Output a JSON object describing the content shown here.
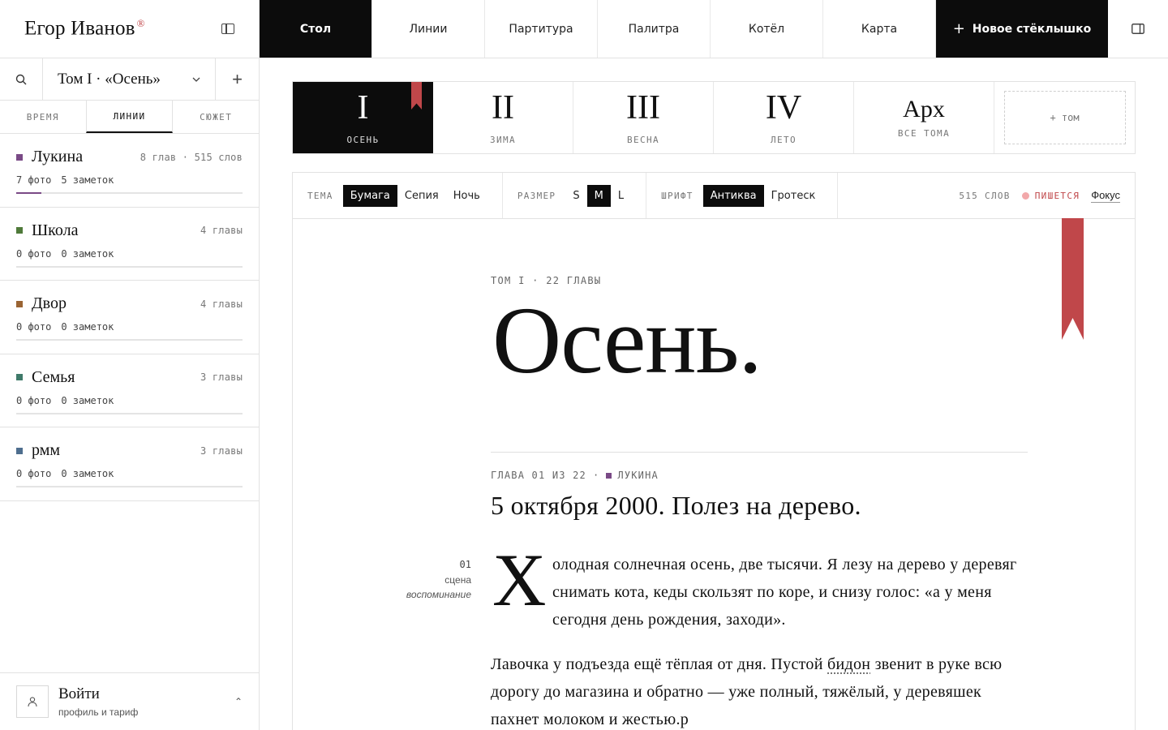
{
  "app": {
    "brand": "Егор Иванов",
    "brand_mark": "®"
  },
  "sidebar": {
    "volume_selector": "Том I · «Осень»",
    "add": "+",
    "tabs": [
      {
        "label": "ВРЕМЯ",
        "active": false
      },
      {
        "label": "ЛИНИИ",
        "active": true
      },
      {
        "label": "СЮЖЕТ",
        "active": false
      }
    ],
    "lines": [
      {
        "name": "Лукина",
        "meta": "8 глав · 515 слов",
        "photos": "7 фото",
        "notes": "5 заметок",
        "color": "#7a4a86",
        "progress": 0.11
      },
      {
        "name": "Школа",
        "meta": "4 главы",
        "photos": "0 фото",
        "notes": "0 заметок",
        "color": "#4f7a3a",
        "progress": 0
      },
      {
        "name": "Двор",
        "meta": "4 главы",
        "photos": "0 фото",
        "notes": "0 заметок",
        "color": "#9a6433",
        "progress": 0
      },
      {
        "name": "Семья",
        "meta": "3 главы",
        "photos": "0 фото",
        "notes": "0 заметок",
        "color": "#3f7a6a",
        "progress": 0
      },
      {
        "name": "рмм",
        "meta": "3 главы",
        "photos": "0 фото",
        "notes": "0 заметок",
        "color": "#4e6e8e",
        "progress": 0
      }
    ],
    "login": {
      "title": "Войти",
      "subtitle": "профиль и тариф",
      "chevron": "⌃"
    }
  },
  "topnav": {
    "items": [
      {
        "label": "Стол",
        "active": true
      },
      {
        "label": "Линии",
        "active": false
      },
      {
        "label": "Партитура",
        "active": false
      },
      {
        "label": "Палитра",
        "active": false
      },
      {
        "label": "Котёл",
        "active": false
      },
      {
        "label": "Карта",
        "active": false
      }
    ],
    "new_button": "Новое стёклышко"
  },
  "volumes": {
    "items": [
      {
        "num": "I",
        "caption": "ОСЕНЬ",
        "active": true
      },
      {
        "num": "II",
        "caption": "ЗИМА",
        "active": false
      },
      {
        "num": "III",
        "caption": "ВЕСНА",
        "active": false
      },
      {
        "num": "IV",
        "caption": "ЛЕТО",
        "active": false
      },
      {
        "num": "Арх",
        "caption": "ВСЕ ТОМА",
        "active": false
      }
    ],
    "add": "+ том"
  },
  "toolbar": {
    "theme_label": "ТЕМА",
    "themes": [
      "Бумага",
      "Сепия",
      "Ночь"
    ],
    "theme_selected": "Бумага",
    "size_label": "РАЗМЕР",
    "sizes": [
      "S",
      "M",
      "L"
    ],
    "size_selected": "M",
    "font_label": "ШРИФТ",
    "fonts": [
      "Антиква",
      "Гротеск"
    ],
    "font_selected": "Антиква",
    "word_count": "515 СЛОВ",
    "status": "ПИШЕТСЯ",
    "status_color": "#c0474a",
    "focus": "Фокус"
  },
  "document": {
    "kicker": "ТОМ I · 22 ГЛАВЫ",
    "title": "Осень.",
    "chapter_meta": "ГЛАВА 01 ИЗ 22",
    "chapter_line": "ЛУКИНА",
    "chapter_line_color": "#7a4a86",
    "chapter_title": "5 октября 2000. Полез на дерево.",
    "scene_number": "01",
    "scene_label": "сцена",
    "scene_tag": "воспоминание",
    "dropcap": "Х",
    "para1": "олодная солнечная осень, две тысячи. Я лезу на дерево у деревяг снимать кота, кеды скользят по коре, и снизу голос: «а у меня сегодня день рождения, заходи».",
    "para2_before": "Лавочка у подъезда ещё тёплая от дня. Пустой ",
    "para2_link": "бидон",
    "para2_after": " звенит в руке всю дорогу до магазина и обратно — уже полный, тяжёлый, у деревяшек пахнет молоком и жестью.р"
  }
}
